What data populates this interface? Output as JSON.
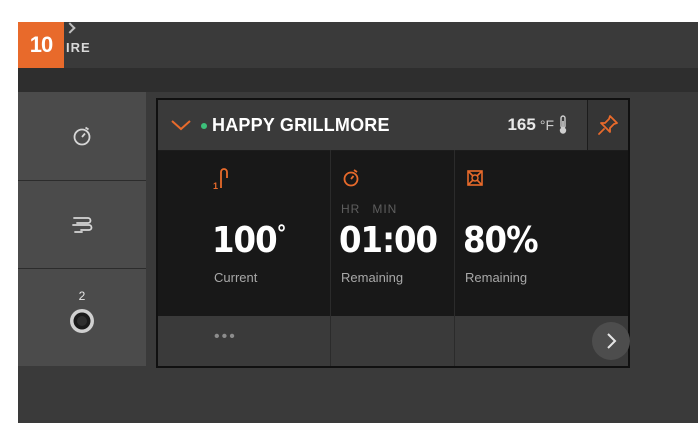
{
  "step_badge": "10",
  "brand": "IRE",
  "device": {
    "name": "HAPPY GRILLMORE",
    "status_color": "#3cc07a",
    "ambient_temp": "165",
    "ambient_unit": "°F"
  },
  "sidebar": {
    "items": [
      {
        "icon": "timer-icon"
      },
      {
        "icon": "smoke-icon"
      },
      {
        "icon": "probe-jack-icon",
        "label": "2"
      }
    ]
  },
  "columns": [
    {
      "icon": "probe-icon",
      "value": "100",
      "unit": "°",
      "label": "Current"
    },
    {
      "icon": "timer-icon",
      "time_units": [
        "HR",
        "MIN"
      ],
      "value": "01:00",
      "label": "Remaining"
    },
    {
      "icon": "pellet-icon",
      "value": "80%",
      "label": "Remaining"
    }
  ],
  "footer": {
    "more_label": "•••"
  },
  "colors": {
    "accent": "#e86a2b",
    "background": "#3a3a3a",
    "card": "#181818"
  }
}
